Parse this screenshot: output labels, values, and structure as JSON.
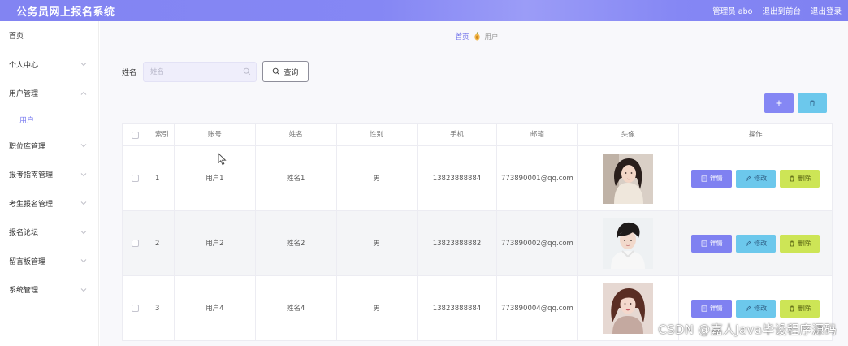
{
  "header": {
    "title": "公务员网上报名系统",
    "admin_label": "管理员 abo",
    "back_front": "退出到前台",
    "logout": "退出登录"
  },
  "sidebar": {
    "items": [
      {
        "label": "首页",
        "has_arrow": false
      },
      {
        "label": "个人中心",
        "has_arrow": true
      },
      {
        "label": "用户管理",
        "has_arrow": true,
        "expanded": true,
        "children": [
          "用户"
        ]
      },
      {
        "label": "职位库管理",
        "has_arrow": true
      },
      {
        "label": "报考指南管理",
        "has_arrow": true
      },
      {
        "label": "考生报名管理",
        "has_arrow": true
      },
      {
        "label": "报名论坛",
        "has_arrow": true
      },
      {
        "label": "留言板管理",
        "has_arrow": true
      },
      {
        "label": "系统管理",
        "has_arrow": true
      }
    ]
  },
  "breadcrumb": {
    "home": "首页",
    "current": "用户"
  },
  "search": {
    "label": "姓名",
    "placeholder": "姓名",
    "button_label": "查询"
  },
  "table": {
    "columns": [
      "索引",
      "账号",
      "姓名",
      "性别",
      "手机",
      "邮箱",
      "头像",
      "操作"
    ],
    "rows": [
      {
        "index": "1",
        "account": "用户1",
        "name": "姓名1",
        "gender": "男",
        "phone": "13823888884",
        "email": "773890001@qq.com",
        "avatar": "female-avatar"
      },
      {
        "index": "2",
        "account": "用户2",
        "name": "姓名2",
        "gender": "男",
        "phone": "13823888882",
        "email": "773890002@qq.com",
        "avatar": "male-avatar"
      },
      {
        "index": "3",
        "account": "用户4",
        "name": "姓名4",
        "gender": "男",
        "phone": "13823888884",
        "email": "773890004@qq.com",
        "avatar": "female-avatar"
      }
    ],
    "actions": {
      "detail": "详情",
      "edit": "修改",
      "delete": "删除"
    }
  },
  "watermark": "CSDN @嘉人Java毕设程序源码",
  "colors": {
    "primary": "#8587f4",
    "info": "#6cc8ec",
    "success": "#cde556"
  }
}
